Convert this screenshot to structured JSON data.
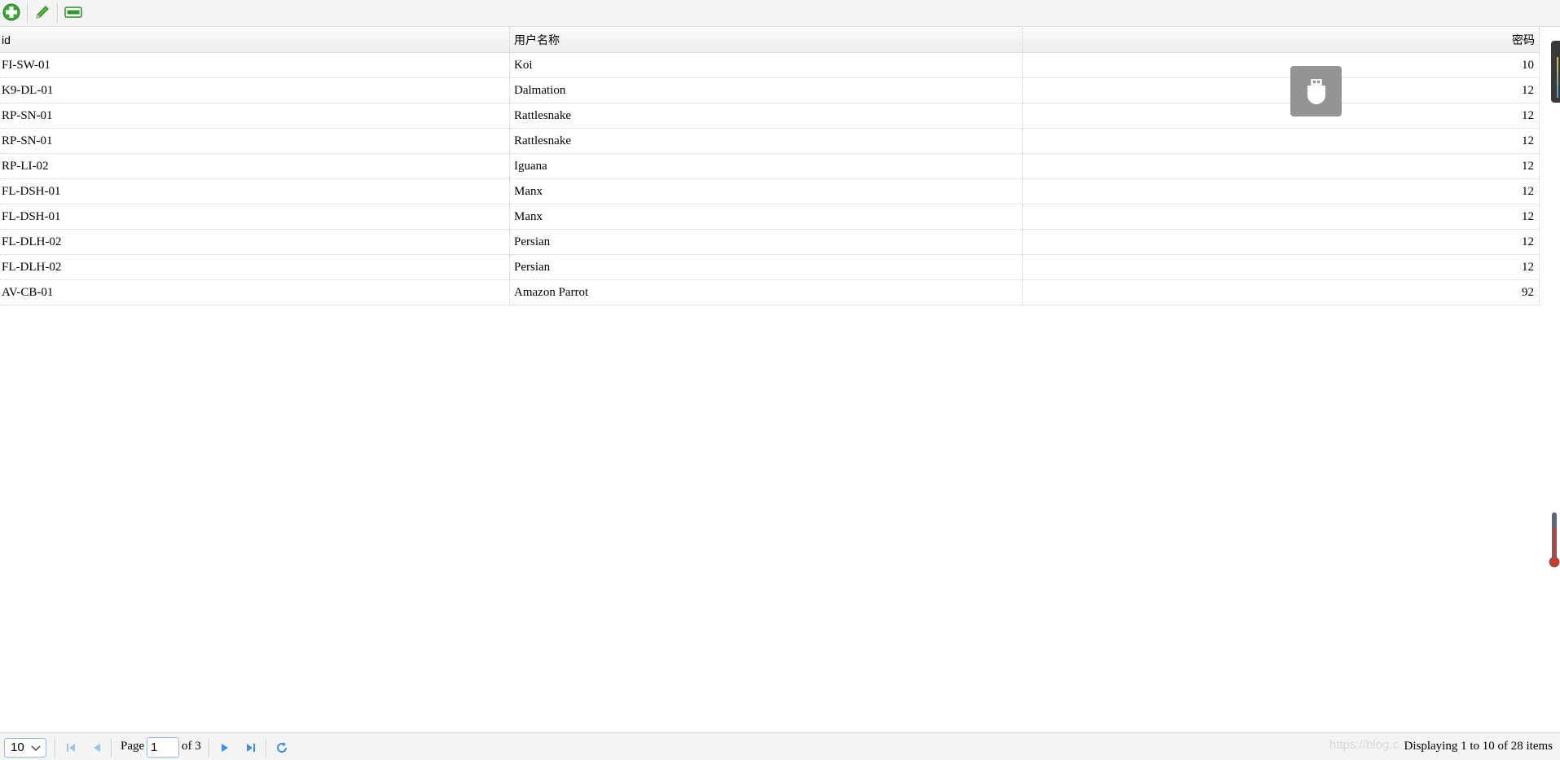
{
  "toolbar": {
    "buttons": [
      {
        "icon": "add-icon",
        "color": "#2a9d2a"
      },
      {
        "icon": "edit-icon",
        "color": "#3aa53a"
      },
      {
        "icon": "remove-icon",
        "color": "#2a9d2a"
      }
    ]
  },
  "grid": {
    "columns": [
      "id",
      "用户名称",
      "密码"
    ],
    "rows": [
      {
        "id": "FI-SW-01",
        "name": "Koi",
        "password": "10"
      },
      {
        "id": "K9-DL-01",
        "name": "Dalmation",
        "password": "12"
      },
      {
        "id": "RP-SN-01",
        "name": "Rattlesnake",
        "password": "12"
      },
      {
        "id": "RP-SN-01",
        "name": "Rattlesnake",
        "password": "12"
      },
      {
        "id": "RP-LI-02",
        "name": "Iguana",
        "password": "12"
      },
      {
        "id": "FL-DSH-01",
        "name": "Manx",
        "password": "12"
      },
      {
        "id": "FL-DSH-01",
        "name": "Manx",
        "password": "12"
      },
      {
        "id": "FL-DLH-02",
        "name": "Persian",
        "password": "12"
      },
      {
        "id": "FL-DLH-02",
        "name": "Persian",
        "password": "12"
      },
      {
        "id": "AV-CB-01",
        "name": "Amazon Parrot",
        "password": "92"
      }
    ]
  },
  "pager": {
    "page_size": "10",
    "page_label": "Page",
    "page_value": "1",
    "of_label": "of 3",
    "watermark": "https://blog.c",
    "displaying": "Displaying 1 to 10 of 28 items",
    "accent": "#3a8ee6"
  }
}
